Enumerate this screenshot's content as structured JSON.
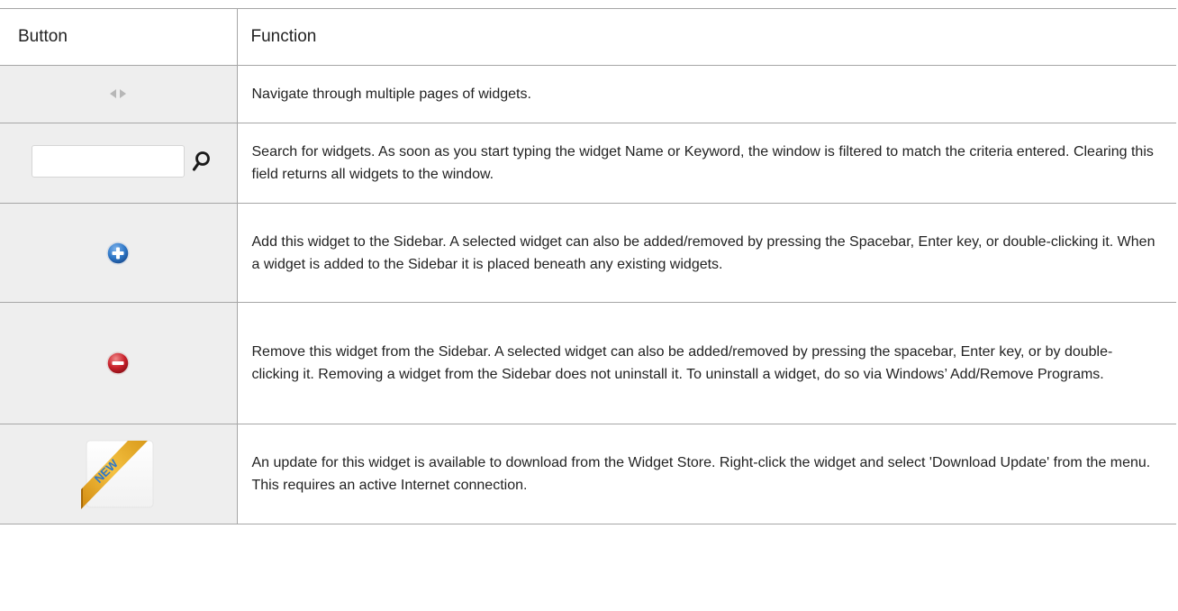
{
  "table": {
    "headers": {
      "button": "Button",
      "function": "Function"
    },
    "rows": [
      {
        "icon": "nav-arrows-icon",
        "description": "Navigate through multiple pages of widgets."
      },
      {
        "icon": "search-field-with-magnifier-icon",
        "description": "Search for widgets. As soon as you start typing the widget Name or Keyword, the window is filtered to match the criteria entered. Clearing this field returns all widgets to the window."
      },
      {
        "icon": "add-plus-icon",
        "description": "Add this widget to the Sidebar. A selected widget can also be added/removed by pressing the Spacebar, Enter key, or double-clicking it. When a widget is added to the Sidebar it is placed beneath any existing widgets."
      },
      {
        "icon": "remove-minus-icon",
        "description": "Remove this widget from the Sidebar. A selected widget can also be added/removed by pressing the spacebar, Enter key, or by double-clicking it. Removing a widget from the Sidebar does not uninstall it. To uninstall a widget, do so via Windows’ Add/Remove Programs."
      },
      {
        "icon": "new-ribbon-icon",
        "icon_text": "NEW",
        "description": "An update for this widget is available to download from the Widget Store. Right-click the widget and select 'Download Update' from the menu. This requires an active Internet connection."
      }
    ]
  },
  "colors": {
    "border": "#a6a6a6",
    "icon_cell_background": "#eeeeee",
    "add_blue": "#2f78c8",
    "remove_red": "#c8202a",
    "ribbon_gold": "#f0b429"
  }
}
